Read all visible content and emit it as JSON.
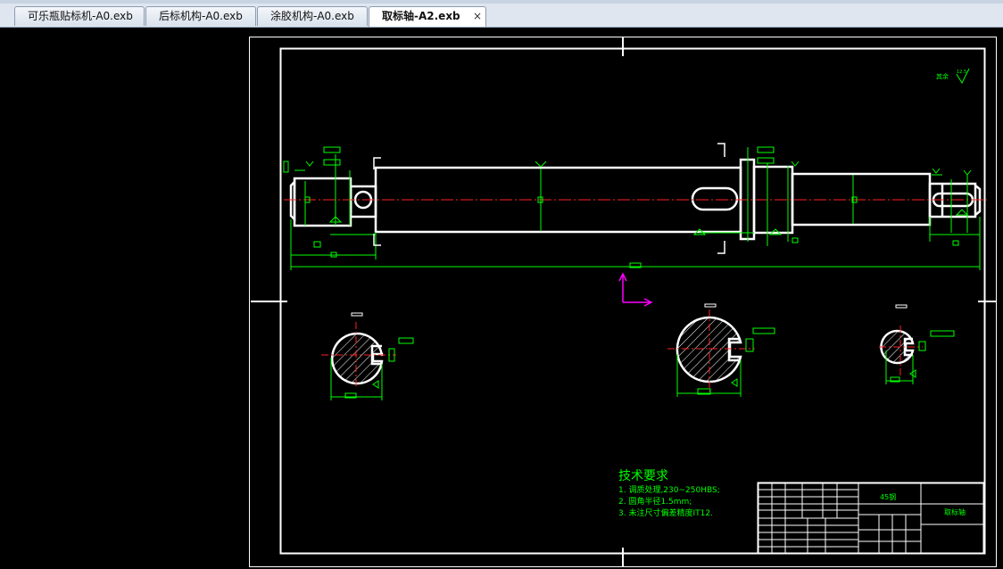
{
  "tabs": [
    {
      "label": "可乐瓶贴标机-A0.exb",
      "active": false
    },
    {
      "label": "后标机构-A0.exb",
      "active": false
    },
    {
      "label": "涂胶机构-A0.exb",
      "active": false
    },
    {
      "label": "取标轴-A2.exb",
      "active": true
    }
  ],
  "tab_close_glyph": "×",
  "drawing": {
    "roughness_note": "其余",
    "roughness_value": "12.5",
    "tech_title": "技术要求",
    "tech_items": [
      "1.  调质处理,230~250HBS;",
      "2.  圆角半径1.5mm;",
      "3.  未注尺寸偏差精度IT12."
    ],
    "title_block": {
      "material": "45钢",
      "part_name": "取标轴"
    }
  },
  "colors": {
    "outline": "#ffffff",
    "dimension": "#00ff00",
    "centerline": "#ff2020",
    "axis": "#ff00ff",
    "background": "#000000"
  }
}
